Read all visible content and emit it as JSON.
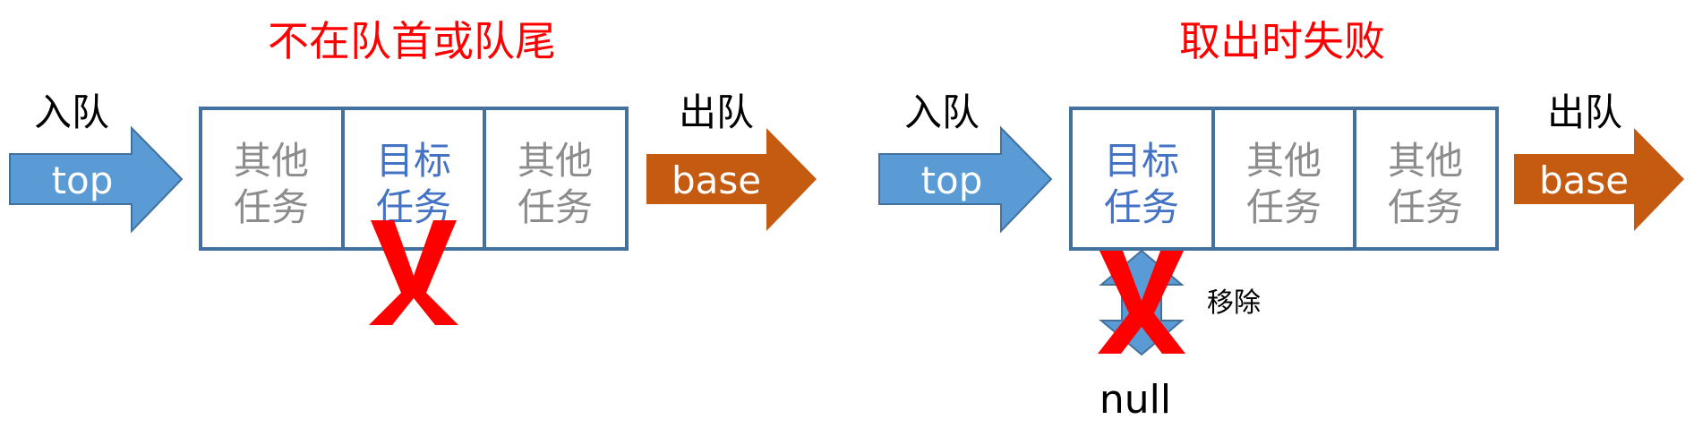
{
  "colors": {
    "title": "#ff0000",
    "cross": "#ff0000",
    "top_arrow": "#5b9bd5",
    "base_arrow": "#c55a11",
    "box_border": "#41719c",
    "other_text": "#8c8c8c",
    "target_text": "#4472c4",
    "label_text": "#000000",
    "arrow_text": "#ffffff"
  },
  "left": {
    "title": "不在队首或队尾",
    "enqueue_label": "入队",
    "dequeue_label": "出队",
    "top_arrow_text": "top",
    "base_arrow_text": "base",
    "cells": [
      {
        "line1": "其他",
        "line2": "任务",
        "kind": "other"
      },
      {
        "line1": "目标",
        "line2": "任务",
        "kind": "target"
      },
      {
        "line1": "其他",
        "line2": "任务",
        "kind": "other"
      }
    ],
    "crossed_cell": 1
  },
  "right": {
    "title": "取出时失败",
    "enqueue_label": "入队",
    "dequeue_label": "出队",
    "top_arrow_text": "top",
    "base_arrow_text": "base",
    "cells": [
      {
        "line1": "目标",
        "line2": "任务",
        "kind": "target"
      },
      {
        "line1": "其他",
        "line2": "任务",
        "kind": "other"
      },
      {
        "line1": "其他",
        "line2": "任务",
        "kind": "other"
      }
    ],
    "remove_label": "移除",
    "null_label": "null"
  }
}
